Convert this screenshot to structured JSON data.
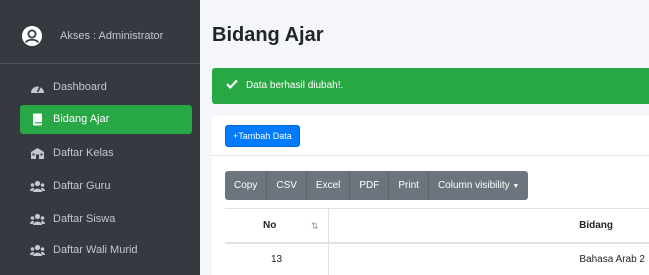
{
  "user": {
    "label": "Akses : Administrator"
  },
  "sidebar": {
    "items": [
      {
        "label": "Dashboard",
        "icon": "tachometer-icon",
        "active": false
      },
      {
        "label": "Bidang Ajar",
        "icon": "book-icon",
        "active": true
      },
      {
        "label": "Daftar Kelas",
        "icon": "school-icon",
        "active": false
      },
      {
        "label": "Daftar Guru",
        "icon": "users-icon",
        "active": false
      },
      {
        "label": "Daftar Siswa",
        "icon": "users-icon",
        "active": false
      },
      {
        "label": "Daftar Wali Murid",
        "icon": "users-icon",
        "active": false
      }
    ]
  },
  "page": {
    "title": "Bidang Ajar"
  },
  "alert": {
    "message": "Data berhasil diubah!.",
    "icon": "check-icon"
  },
  "card": {
    "add_button_label": "Tambah Data"
  },
  "export_buttons": [
    "Copy",
    "CSV",
    "Excel",
    "PDF",
    "Print",
    "Column visibility"
  ],
  "table": {
    "columns": [
      "No",
      "Bidang"
    ],
    "rows": [
      {
        "no": "13",
        "bidang": "Bahasa Arab 2"
      }
    ]
  },
  "colors": {
    "sidebar_bg": "#343a40",
    "active_green": "#28a745",
    "primary_blue": "#007bff",
    "secondary_gray": "#6c757d"
  }
}
